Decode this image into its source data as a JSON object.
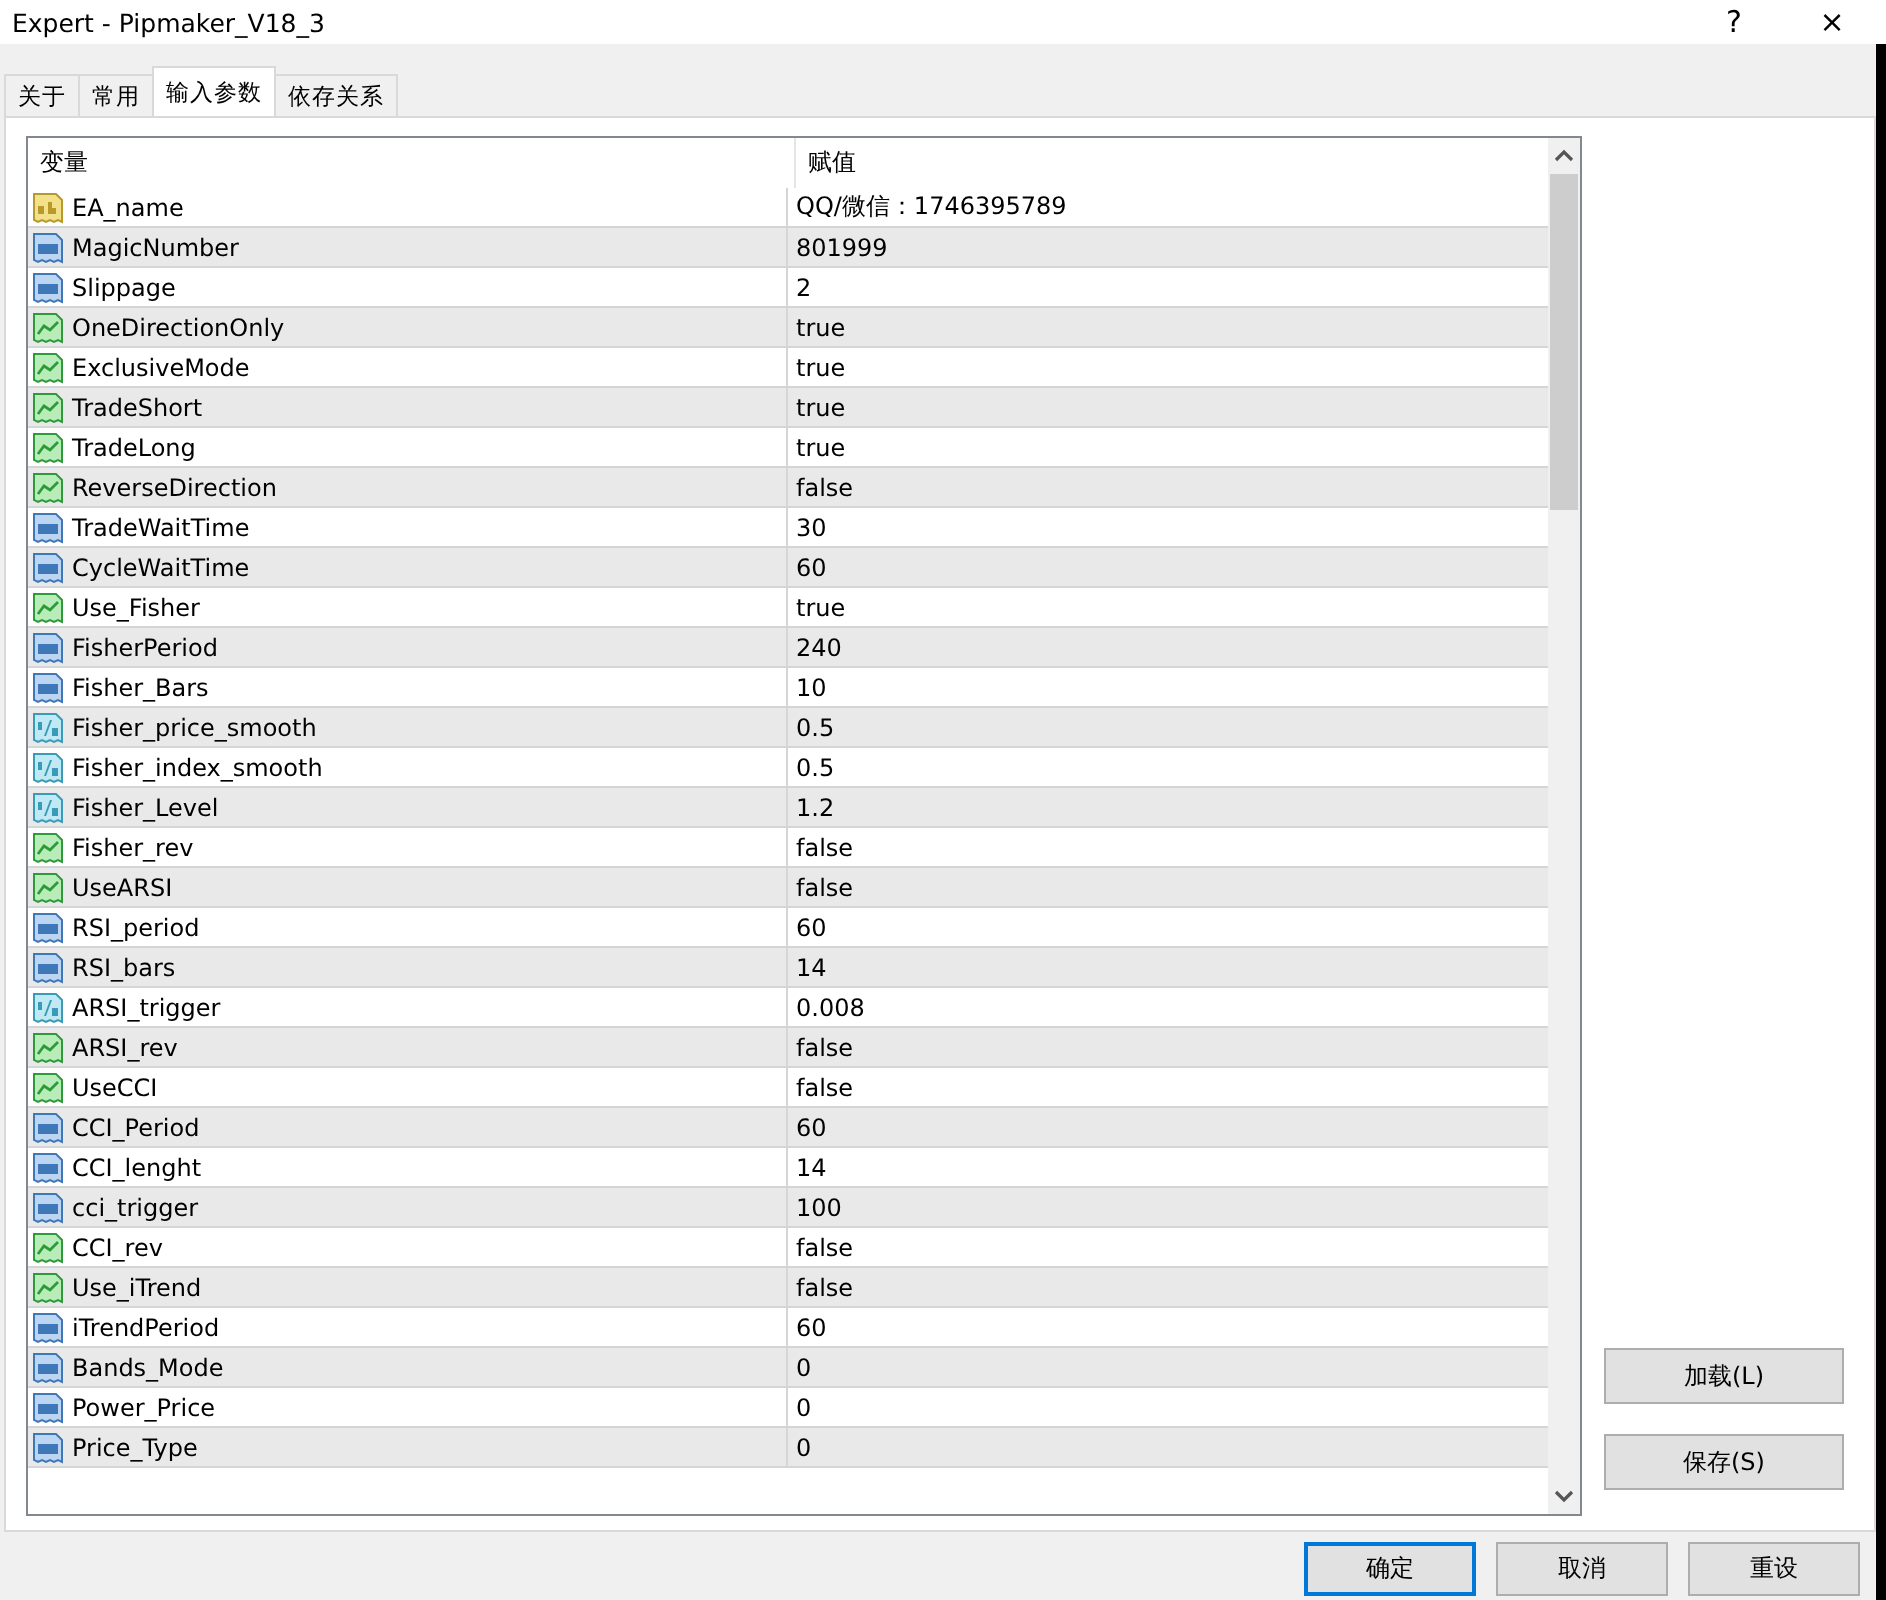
{
  "window": {
    "title": "Expert - Pipmaker_V18_3",
    "help_button": "?",
    "close_button": "×"
  },
  "tabs": [
    {
      "label": "关于",
      "selected": false
    },
    {
      "label": "常用",
      "selected": false
    },
    {
      "label": "输入参数",
      "selected": true
    },
    {
      "label": "依存关系",
      "selected": false
    }
  ],
  "table": {
    "columns": [
      "变量",
      "赋值"
    ],
    "rows": [
      {
        "kind": "string",
        "name": "EA_name",
        "value": "QQ/微信：1746395789"
      },
      {
        "kind": "int",
        "name": "MagicNumber",
        "value": "801999"
      },
      {
        "kind": "int",
        "name": "Slippage",
        "value": "2"
      },
      {
        "kind": "bool",
        "name": "OneDirectionOnly",
        "value": "true"
      },
      {
        "kind": "bool",
        "name": "ExclusiveMode",
        "value": "true"
      },
      {
        "kind": "bool",
        "name": "TradeShort",
        "value": "true"
      },
      {
        "kind": "bool",
        "name": "TradeLong",
        "value": "true"
      },
      {
        "kind": "bool",
        "name": "ReverseDirection",
        "value": "false"
      },
      {
        "kind": "int",
        "name": "TradeWaitTime",
        "value": "30"
      },
      {
        "kind": "int",
        "name": "CycleWaitTime",
        "value": "60"
      },
      {
        "kind": "bool",
        "name": "Use_Fisher",
        "value": "true"
      },
      {
        "kind": "int",
        "name": "FisherPeriod",
        "value": "240"
      },
      {
        "kind": "int",
        "name": "Fisher_Bars",
        "value": "10"
      },
      {
        "kind": "double",
        "name": "Fisher_price_smooth",
        "value": "0.5"
      },
      {
        "kind": "double",
        "name": "Fisher_index_smooth",
        "value": "0.5"
      },
      {
        "kind": "double",
        "name": "Fisher_Level",
        "value": "1.2"
      },
      {
        "kind": "bool",
        "name": "Fisher_rev",
        "value": "false"
      },
      {
        "kind": "bool",
        "name": "UseARSI",
        "value": "false"
      },
      {
        "kind": "int",
        "name": "RSI_period",
        "value": "60"
      },
      {
        "kind": "int",
        "name": "RSI_bars",
        "value": "14"
      },
      {
        "kind": "double",
        "name": "ARSI_trigger",
        "value": "0.008"
      },
      {
        "kind": "bool",
        "name": "ARSI_rev",
        "value": "false"
      },
      {
        "kind": "bool",
        "name": "UseCCI",
        "value": "false"
      },
      {
        "kind": "int",
        "name": "CCI_Period",
        "value": "60"
      },
      {
        "kind": "int",
        "name": "CCI_lenght",
        "value": "14"
      },
      {
        "kind": "int",
        "name": "cci_trigger",
        "value": "100"
      },
      {
        "kind": "bool",
        "name": "CCI_rev",
        "value": "false"
      },
      {
        "kind": "bool",
        "name": "Use_iTrend",
        "value": "false"
      },
      {
        "kind": "int",
        "name": "iTrendPeriod",
        "value": "60"
      },
      {
        "kind": "int",
        "name": "Bands_Mode",
        "value": "0"
      },
      {
        "kind": "int",
        "name": "Power_Price",
        "value": "0"
      },
      {
        "kind": "int",
        "name": "Price_Type",
        "value": "0"
      }
    ]
  },
  "side_buttons": [
    "加载(L)",
    "保存(S)"
  ],
  "footer_buttons": [
    {
      "label": "确定",
      "selected": true
    },
    {
      "label": "取消",
      "selected": false
    },
    {
      "label": "重设",
      "selected": false
    }
  ]
}
